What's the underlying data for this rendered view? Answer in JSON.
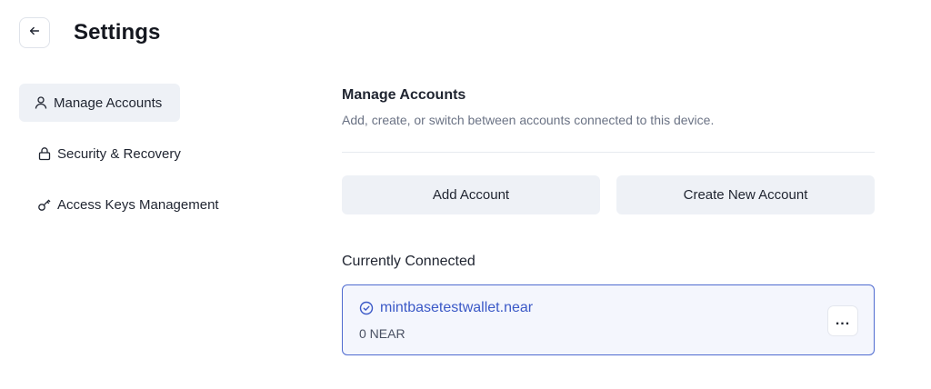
{
  "header": {
    "title": "Settings",
    "back_icon": "arrow-left-icon"
  },
  "sidebar": {
    "items": [
      {
        "label": "Manage Accounts",
        "icon": "user-icon",
        "active": true
      },
      {
        "label": "Security & Recovery",
        "icon": "lock-icon",
        "active": false
      },
      {
        "label": "Access Keys Management",
        "icon": "key-icon",
        "active": false
      }
    ]
  },
  "main": {
    "section_title": "Manage Accounts",
    "section_description": "Add, create, or switch between accounts connected to this device.",
    "add_account_label": "Add Account",
    "create_account_label": "Create New Account",
    "connected_label": "Currently Connected",
    "account": {
      "name": "mintbasetestwallet.near",
      "balance": "0 NEAR",
      "status_icon": "check-circle-icon",
      "more_label": "..."
    }
  },
  "colors": {
    "accent": "#3b59c7",
    "card_border": "#4f6bd0",
    "button_bg": "#eef1f6"
  }
}
